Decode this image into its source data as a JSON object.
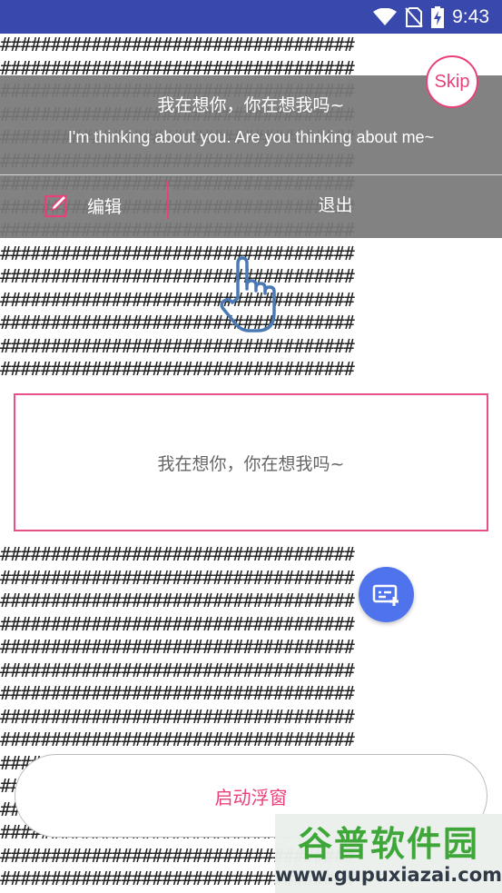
{
  "status_bar": {
    "time": "9:43",
    "icons": [
      "wifi-icon",
      "no-sim-icon",
      "battery-charging-icon"
    ]
  },
  "background_text": "###################################",
  "guide_overlay": {
    "line_chinese": "我在想你，你在想我吗~",
    "line_english": "I'm thinking about you. Are you thinking about me~",
    "edit_label": "编辑",
    "exit_label": "退出",
    "skip_label": "Skip"
  },
  "preview_box": {
    "text": "我在想你，你在想我吗~"
  },
  "launch_button": {
    "label": "启动浮窗"
  },
  "watermark": {
    "logo_text": "谷普软件园",
    "url": "www.gupuxiazai.com"
  },
  "colors": {
    "status_bar": "#3848ad",
    "accent_pink": "#e8417a",
    "fab_blue": "#4f73ec",
    "overlay_gray": "#787878"
  }
}
